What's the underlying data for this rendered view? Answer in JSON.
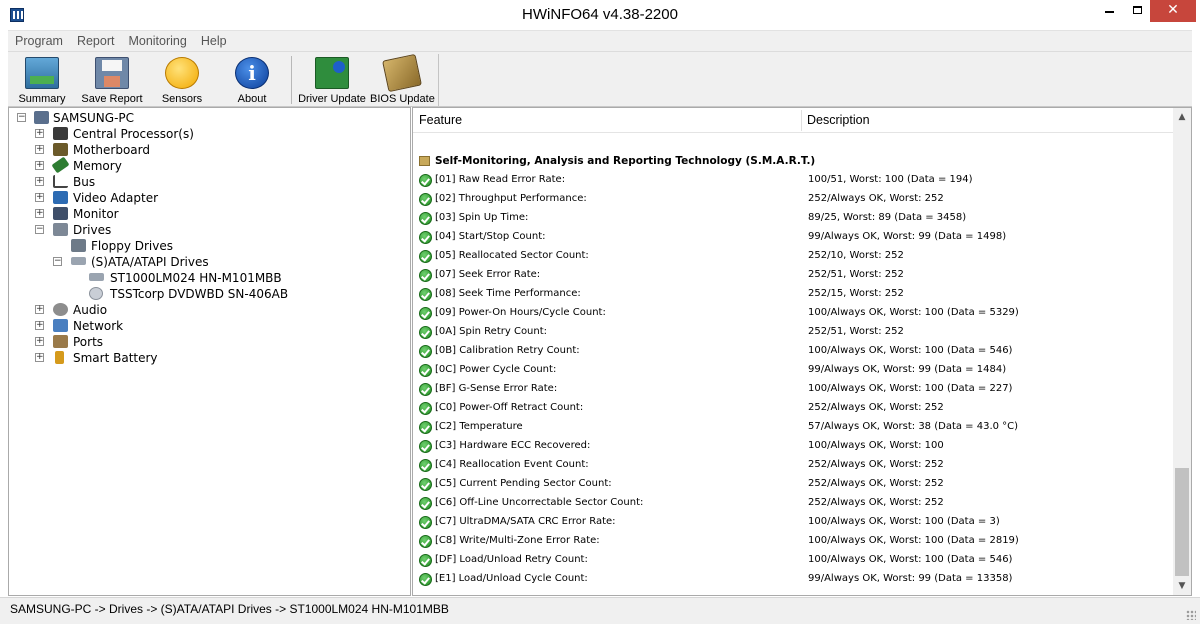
{
  "window": {
    "title": "HWiNFO64 v4.38-2200",
    "close_glyph": "✕"
  },
  "menu": [
    "Program",
    "Report",
    "Monitoring",
    "Help"
  ],
  "toolbar": {
    "summary": "Summary",
    "save_report": "Save Report",
    "sensors": "Sensors",
    "about": "About",
    "about_glyph": "i",
    "driver_update": "Driver Update",
    "bios_update": "BIOS Update"
  },
  "tree": {
    "root": "SAMSUNG-PC",
    "items": [
      {
        "label": "Central Processor(s)",
        "icon": "cpu-icon",
        "color": "#3a3a3a"
      },
      {
        "label": "Motherboard",
        "icon": "motherboard-icon",
        "color": "#6b5a2a"
      },
      {
        "label": "Memory",
        "icon": "memory-icon",
        "color": "#2e7d32"
      },
      {
        "label": "Bus",
        "icon": "bus-icon",
        "color": "#555555"
      },
      {
        "label": "Video Adapter",
        "icon": "video-adapter-icon",
        "color": "#2d6bb3"
      },
      {
        "label": "Monitor",
        "icon": "monitor-icon",
        "color": "#3f4f6a"
      },
      {
        "label": "Drives",
        "icon": "drives-icon",
        "color": "#7d8896"
      }
    ],
    "drives_children": {
      "floppy": "Floppy Drives",
      "sata": "(S)ATA/ATAPI Drives",
      "hdd": "ST1000LM024 HN-M101MBB",
      "dvd": "TSSTcorp DVDWBD SN-406AB"
    },
    "after_items": [
      {
        "label": "Audio",
        "icon": "audio-icon",
        "color": "#8d8d8d"
      },
      {
        "label": "Network",
        "icon": "network-icon",
        "color": "#4a7fc0"
      },
      {
        "label": "Ports",
        "icon": "ports-icon",
        "color": "#9a7a4a"
      },
      {
        "label": "Smart Battery",
        "icon": "battery-icon",
        "color": "#d59a1c"
      }
    ],
    "expand_glyph": "+",
    "collapse_glyph": "−"
  },
  "panel": {
    "col_feature": "Feature",
    "col_description": "Description",
    "section_title": "Self-Monitoring, Analysis and Reporting Technology (S.M.A.R.T.)",
    "rows": [
      {
        "feature": "[01] Raw Read Error Rate:",
        "description": "100/51, Worst: 100 (Data = 194)"
      },
      {
        "feature": "[02] Throughput Performance:",
        "description": "252/Always OK, Worst: 252"
      },
      {
        "feature": "[03] Spin Up Time:",
        "description": "89/25, Worst: 89 (Data = 3458)"
      },
      {
        "feature": "[04] Start/Stop Count:",
        "description": "99/Always OK, Worst: 99 (Data = 1498)"
      },
      {
        "feature": "[05] Reallocated Sector Count:",
        "description": "252/10, Worst: 252"
      },
      {
        "feature": "[07] Seek Error Rate:",
        "description": "252/51, Worst: 252"
      },
      {
        "feature": "[08] Seek Time Performance:",
        "description": "252/15, Worst: 252"
      },
      {
        "feature": "[09] Power-On Hours/Cycle Count:",
        "description": "100/Always OK, Worst: 100 (Data = 5329)"
      },
      {
        "feature": "[0A] Spin Retry Count:",
        "description": "252/51, Worst: 252"
      },
      {
        "feature": "[0B] Calibration Retry Count:",
        "description": "100/Always OK, Worst: 100 (Data = 546)"
      },
      {
        "feature": "[0C] Power Cycle Count:",
        "description": "99/Always OK, Worst: 99 (Data = 1484)"
      },
      {
        "feature": "[BF] G-Sense Error Rate:",
        "description": "100/Always OK, Worst: 100 (Data = 227)"
      },
      {
        "feature": "[C0] Power-Off Retract Count:",
        "description": "252/Always OK, Worst: 252"
      },
      {
        "feature": "[C2] Temperature",
        "description": "57/Always OK, Worst: 38 (Data = 43.0 °C)"
      },
      {
        "feature": "[C3] Hardware ECC Recovered:",
        "description": "100/Always OK, Worst: 100"
      },
      {
        "feature": "[C4] Reallocation Event Count:",
        "description": "252/Always OK, Worst: 252"
      },
      {
        "feature": "[C5] Current Pending Sector Count:",
        "description": "252/Always OK, Worst: 252"
      },
      {
        "feature": "[C6] Off-Line Uncorrectable Sector Count:",
        "description": "252/Always OK, Worst: 252"
      },
      {
        "feature": "[C7] UltraDMA/SATA CRC Error Rate:",
        "description": "100/Always OK, Worst: 100 (Data = 3)"
      },
      {
        "feature": "[C8] Write/Multi-Zone Error Rate:",
        "description": "100/Always OK, Worst: 100 (Data = 2819)"
      },
      {
        "feature": "[DF] Load/Unload Retry Count:",
        "description": "100/Always OK, Worst: 100 (Data = 546)"
      },
      {
        "feature": "[E1] Load/Unload Cycle Count:",
        "description": "99/Always OK, Worst: 99 (Data = 13358)"
      }
    ],
    "scroll_up_glyph": "▲",
    "scroll_down_glyph": "▼"
  },
  "status": "SAMSUNG-PC -> Drives -> (S)ATA/ATAPI Drives -> ST1000LM024 HN-M101MBB"
}
